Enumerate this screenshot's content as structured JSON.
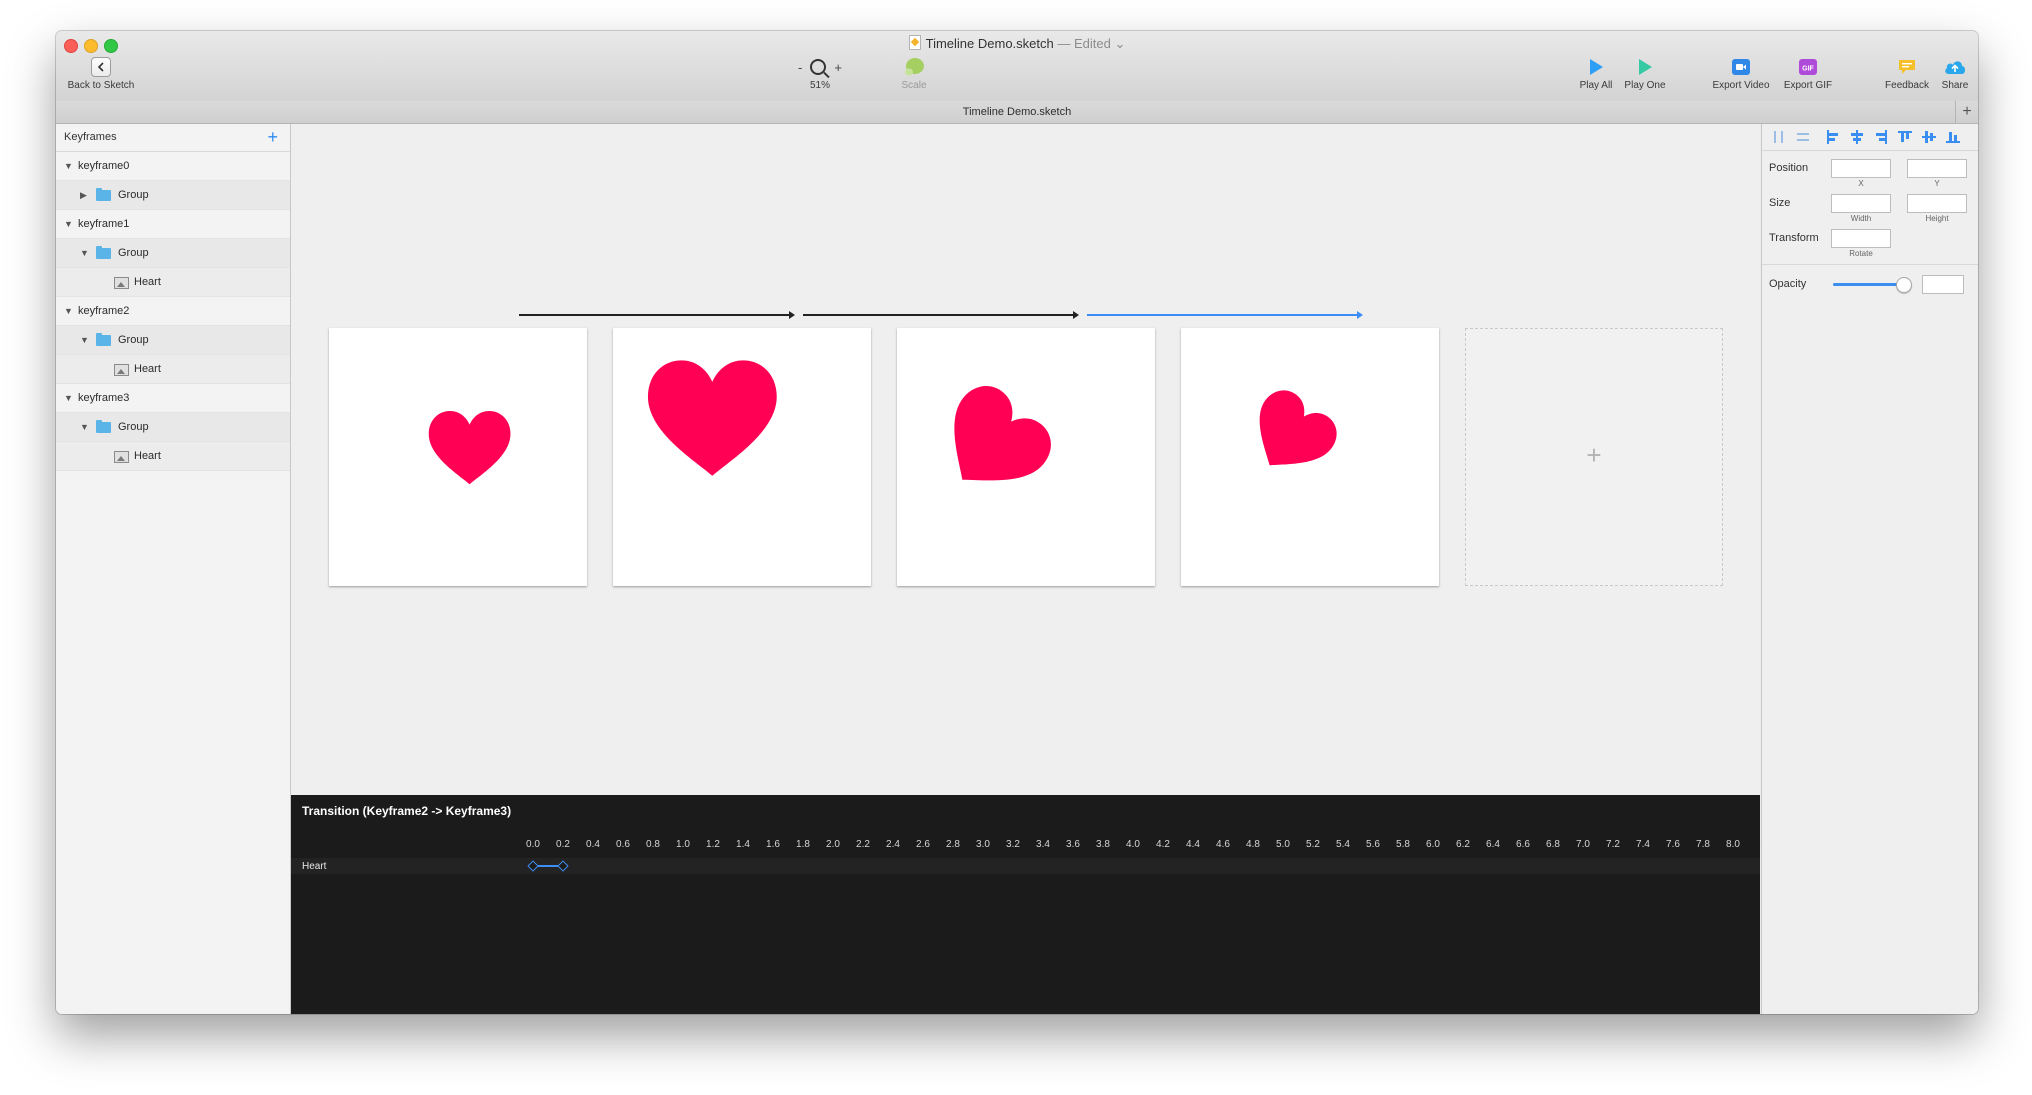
{
  "window": {
    "title": "Timeline Demo.sketch",
    "edited": "— Edited"
  },
  "toolbar": {
    "back_label": "Back to Sketch",
    "zoom_minus": "-",
    "zoom_plus": "+",
    "zoom_value": "51%",
    "scale_label": "Scale",
    "play_all_label": "Play All",
    "play_one_label": "Play One",
    "export_video_label": "Export Video",
    "export_gif_label": "Export GIF",
    "gif_badge": "GIF",
    "feedback_label": "Feedback",
    "share_label": "Share"
  },
  "tabbar": {
    "title": "Timeline Demo.sketch",
    "add": "+"
  },
  "sidebar": {
    "header": "Keyframes",
    "add": "+",
    "rows": [
      {
        "label": "keyframe0",
        "level": 0,
        "icon": "none",
        "expanded": true
      },
      {
        "label": "Group",
        "level": 1,
        "icon": "folder-icon",
        "expanded": false
      },
      {
        "label": "keyframe1",
        "level": 0,
        "icon": "none",
        "expanded": true
      },
      {
        "label": "Group",
        "level": 1,
        "icon": "folder-icon",
        "expanded": true
      },
      {
        "label": "Heart",
        "level": 2,
        "icon": "image-icon",
        "expanded": false
      },
      {
        "label": "keyframe2",
        "level": 0,
        "icon": "none",
        "expanded": true
      },
      {
        "label": "Group",
        "level": 1,
        "icon": "folder-icon",
        "expanded": true
      },
      {
        "label": "Heart",
        "level": 2,
        "icon": "image-icon",
        "expanded": false
      },
      {
        "label": "keyframe3",
        "level": 0,
        "icon": "none",
        "expanded": true
      },
      {
        "label": "Group",
        "level": 1,
        "icon": "folder-icon",
        "expanded": true
      },
      {
        "label": "Heart",
        "level": 2,
        "icon": "image-icon",
        "expanded": false
      }
    ]
  },
  "canvas": {
    "heart_color": "#ff0055",
    "transition_color": "#222222",
    "active_transition_color": "#3b8ef5",
    "add_frame": "+"
  },
  "timeline": {
    "title": "Transition (Keyframe2 -> Keyframe3)",
    "ticks": [
      "0.0",
      "0.2",
      "0.4",
      "0.6",
      "0.8",
      "1.0",
      "1.2",
      "1.4",
      "1.6",
      "1.8",
      "2.0",
      "2.2",
      "2.4",
      "2.6",
      "2.8",
      "3.0",
      "3.2",
      "3.4",
      "3.6",
      "3.8",
      "4.0",
      "4.2",
      "4.4",
      "4.6",
      "4.8",
      "5.0",
      "5.2",
      "5.4",
      "5.6",
      "5.8",
      "6.0",
      "6.2",
      "6.4",
      "6.6",
      "6.8",
      "7.0",
      "7.2",
      "7.4",
      "7.6",
      "7.8",
      "8.0",
      "8"
    ],
    "track_label": "Heart",
    "keyframe_start": 0.0,
    "keyframe_end": 0.2,
    "accent": "#3e8ef7"
  },
  "inspector": {
    "position_label": "Position",
    "x_label": "X",
    "y_label": "Y",
    "size_label": "Size",
    "width_label": "Width",
    "height_label": "Height",
    "transform_label": "Transform",
    "rotate_label": "Rotate",
    "opacity_label": "Opacity",
    "opacity_value": 0.95
  }
}
